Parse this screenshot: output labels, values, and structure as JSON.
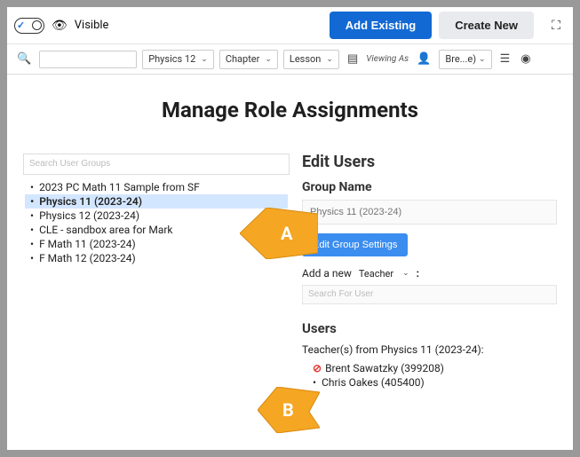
{
  "toolbar1": {
    "visible_label": "Visible",
    "add_existing": "Add Existing",
    "create_new": "Create New"
  },
  "toolbar2": {
    "course": "Physics 12",
    "chapter": "Chapter",
    "lesson": "Lesson",
    "viewing_as": "Viewing As",
    "user": "Bre...e)"
  },
  "page": {
    "title": "Manage Role Assignments"
  },
  "groups": {
    "search_placeholder": "Search User Groups",
    "items": [
      "2023 PC Math 11 Sample from SF",
      "Physics 11 (2023-24)",
      "Physics 12 (2023-24)",
      "CLE - sandbox area for Mark",
      "F Math 11 (2023-24)",
      "F Math 12 (2023-24)"
    ],
    "selected_index": 1
  },
  "edit": {
    "header": "Edit Users",
    "group_name_label": "Group Name",
    "group_name_value": "Physics 11 (2023-24)",
    "edit_settings": "Edit Group Settings",
    "add_new_label": "Add a new",
    "role": "Teacher",
    "user_search_placeholder": "Search For User"
  },
  "users": {
    "header": "Users",
    "teachers_from": "Teacher(s) from Physics 11 (2023-24):",
    "list": [
      {
        "name": "Brent Sawatzky (399208)",
        "removable": true
      },
      {
        "name": "Chris Oakes (405400)",
        "removable": false
      }
    ]
  },
  "callouts": {
    "a": "A",
    "b": "B"
  }
}
